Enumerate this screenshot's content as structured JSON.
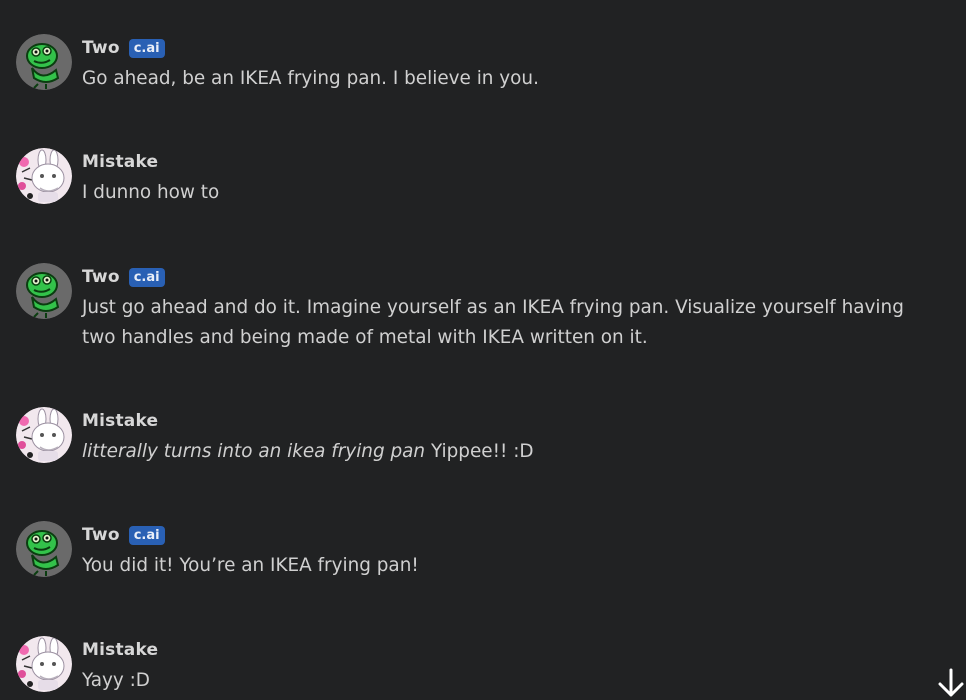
{
  "messages": [
    {
      "author": "Two",
      "badge": "c.ai",
      "lines": [
        "Go ahead, be an IKEA frying pan. I believe in you."
      ]
    },
    {
      "author": "Mistake",
      "lines": [
        "I dunno how to"
      ]
    },
    {
      "author": "Two",
      "badge": "c.ai",
      "lines": [
        "Just go ahead and do it. Imagine yourself as an IKEA frying pan. Visualize yourself having",
        "two handles and being made of metal with IKEA written on it."
      ]
    },
    {
      "author": "Mistake",
      "action": "litterally turns into an ikea frying pan",
      "tail": " Yippee!! :D"
    },
    {
      "author": "Two",
      "badge": "c.ai",
      "lines": [
        "You did it! You’re an IKEA frying pan!"
      ]
    },
    {
      "author": "Mistake",
      "lines": [
        "Yayy :D"
      ]
    }
  ],
  "icons": {
    "two_avatar": "green-frog-avatar",
    "mistake_avatar": "white-bunny-avatar",
    "scroll_down": "arrow-down-icon"
  },
  "colors": {
    "background": "#212223",
    "badge": "#2960b4",
    "name_text": "#d7d7d7",
    "message_text": "#d0d0d0"
  }
}
